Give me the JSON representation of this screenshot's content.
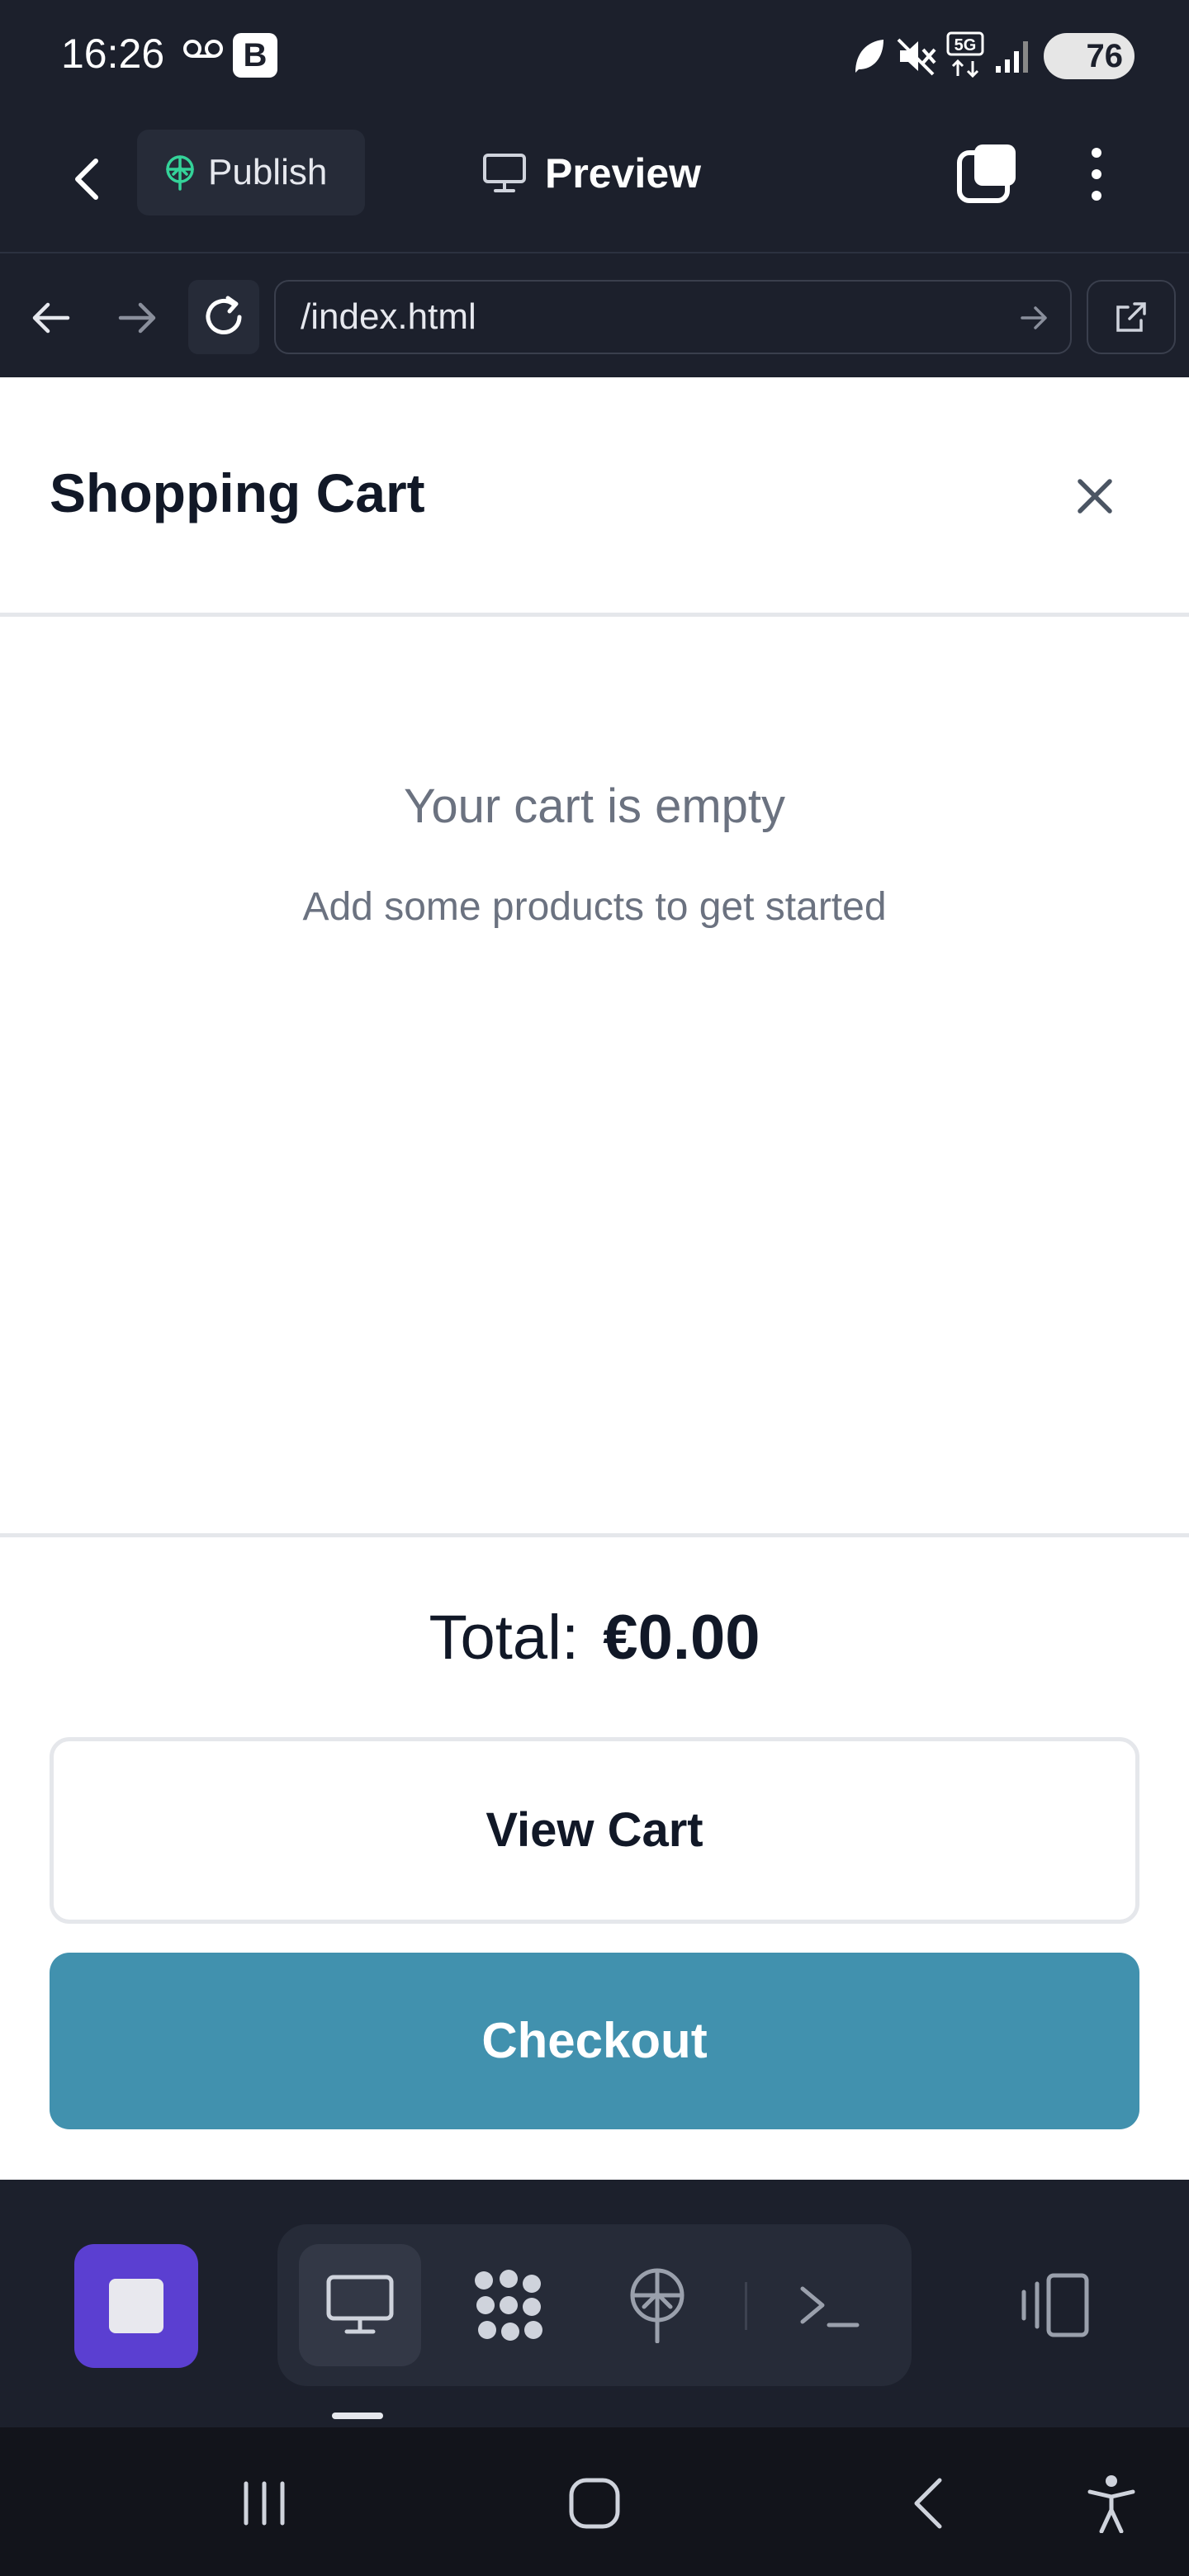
{
  "status_bar": {
    "time": "16:26",
    "badge_letter": "B",
    "battery": "76",
    "icons": [
      "voicemail-icon",
      "leaf-icon",
      "mute-icon",
      "5g-icon",
      "signal-icon",
      "battery-icon"
    ]
  },
  "toolbar": {
    "publish_label": "Publish",
    "preview_label": "Preview",
    "icons": [
      "back-icon",
      "publish-icon",
      "monitor-icon",
      "tabs-icon",
      "more-vertical-icon"
    ]
  },
  "url_bar": {
    "url": "/index.html",
    "icons": [
      "arrow-left-icon",
      "arrow-right-icon",
      "reload-icon",
      "go-arrow-icon",
      "external-link-icon"
    ]
  },
  "cart": {
    "title": "Shopping Cart",
    "empty_title": "Your cart is empty",
    "empty_subtitle": "Add some products to get started",
    "total_label": "Total:",
    "total_amount": "€0.00",
    "view_cart_label": "View Cart",
    "checkout_label": "Checkout"
  },
  "dock": {
    "icons": [
      "stop-icon",
      "monitor-icon",
      "dots-grid-icon",
      "publish-icon",
      "terminal-icon",
      "devices-icon"
    ]
  },
  "nav": {
    "icons": [
      "recents-icon",
      "home-icon",
      "back-icon",
      "accessibility-icon"
    ]
  },
  "colors": {
    "dark_bg": "#1c202c",
    "checkout": "#4191ae",
    "stop_button": "#5b3fd1",
    "muted_text": "#6b7280"
  }
}
